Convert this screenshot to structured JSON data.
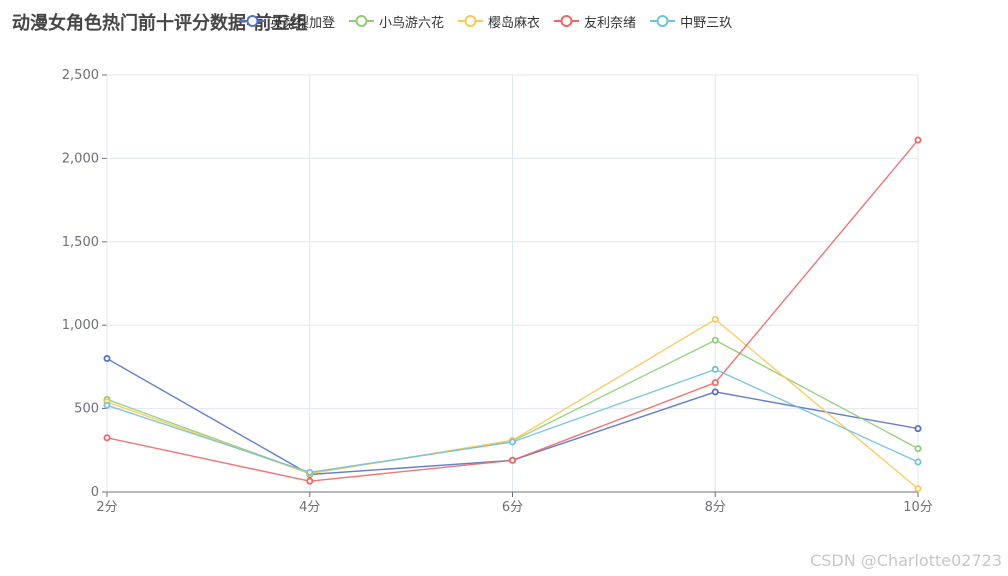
{
  "chart_data": {
    "type": "line",
    "title": "动漫女角色热门前十评分数据-前五组",
    "categories": [
      "2分",
      "4分",
      "6分",
      "8分",
      "10分"
    ],
    "ylim": [
      0,
      2500
    ],
    "y_ticks": [
      "0",
      "500",
      "1,000",
      "1,500",
      "2,000",
      "2,500"
    ],
    "grid": true,
    "legend_position": "top",
    "series": [
      {
        "name": "英梨梨加登",
        "color": "#5470c6",
        "values": [
          800,
          105,
          190,
          600,
          380
        ]
      },
      {
        "name": "小鸟游六花",
        "color": "#91cc75",
        "values": [
          555,
          112,
          305,
          910,
          260
        ]
      },
      {
        "name": "樱岛麻衣",
        "color": "#fac858",
        "values": [
          540,
          110,
          310,
          1035,
          20
        ]
      },
      {
        "name": "友利奈绪",
        "color": "#ee6666",
        "values": [
          325,
          65,
          190,
          655,
          2110
        ]
      },
      {
        "name": "中野三玖",
        "color": "#73c0de",
        "values": [
          520,
          118,
          300,
          735,
          180
        ]
      }
    ]
  },
  "watermark": "CSDN @Charlotte02723"
}
